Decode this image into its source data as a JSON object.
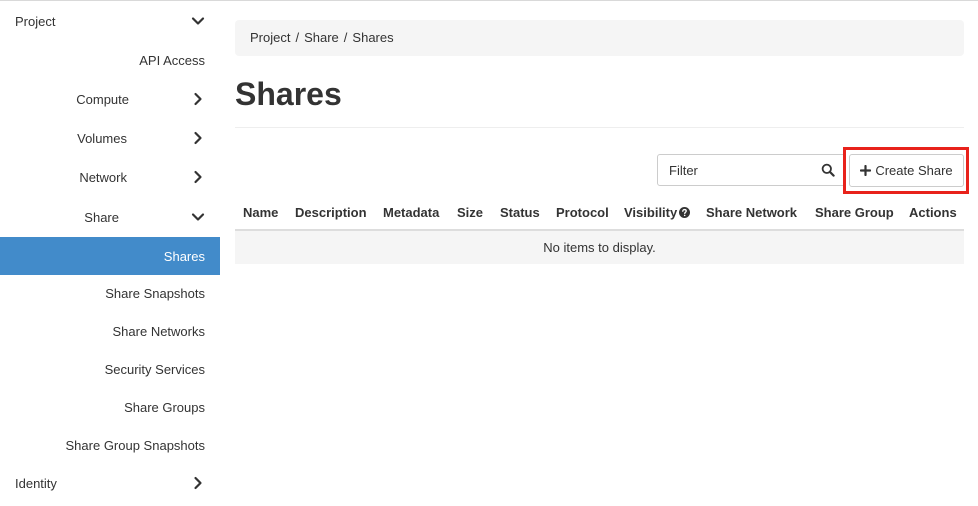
{
  "sidebar": {
    "project": {
      "label": "Project",
      "icon": "chevron-down-icon"
    },
    "api_access": {
      "label": "API Access"
    },
    "compute": {
      "label": "Compute",
      "icon": "chevron-right-icon"
    },
    "volumes": {
      "label": "Volumes",
      "icon": "chevron-right-icon"
    },
    "network": {
      "label": "Network",
      "icon": "chevron-right-icon"
    },
    "share": {
      "label": "Share",
      "icon": "chevron-down-icon"
    },
    "share_items": [
      {
        "label": "Shares",
        "active": true
      },
      {
        "label": "Share Snapshots"
      },
      {
        "label": "Share Networks"
      },
      {
        "label": "Security Services"
      },
      {
        "label": "Share Groups"
      },
      {
        "label": "Share Group Snapshots"
      }
    ],
    "identity": {
      "label": "Identity",
      "icon": "chevron-right-icon"
    }
  },
  "breadcrumb": {
    "items": [
      "Project",
      "Share",
      "Shares"
    ],
    "separator": "/"
  },
  "page": {
    "title": "Shares"
  },
  "toolbar": {
    "filter_placeholder": "Filter",
    "search_icon": "search-icon",
    "create_label": "Create Share",
    "create_icon": "plus-icon"
  },
  "table": {
    "columns": [
      "Name",
      "Description",
      "Metadata",
      "Size",
      "Status",
      "Protocol",
      "Visibility",
      "Share Network",
      "Share Group",
      "Actions"
    ],
    "visibility_help_icon": "question-circle-icon",
    "empty_text": "No items to display."
  },
  "colors": {
    "active_nav": "#428bca",
    "highlight": "#e8221b",
    "breadcrumb_bg": "#f5f5f5"
  }
}
